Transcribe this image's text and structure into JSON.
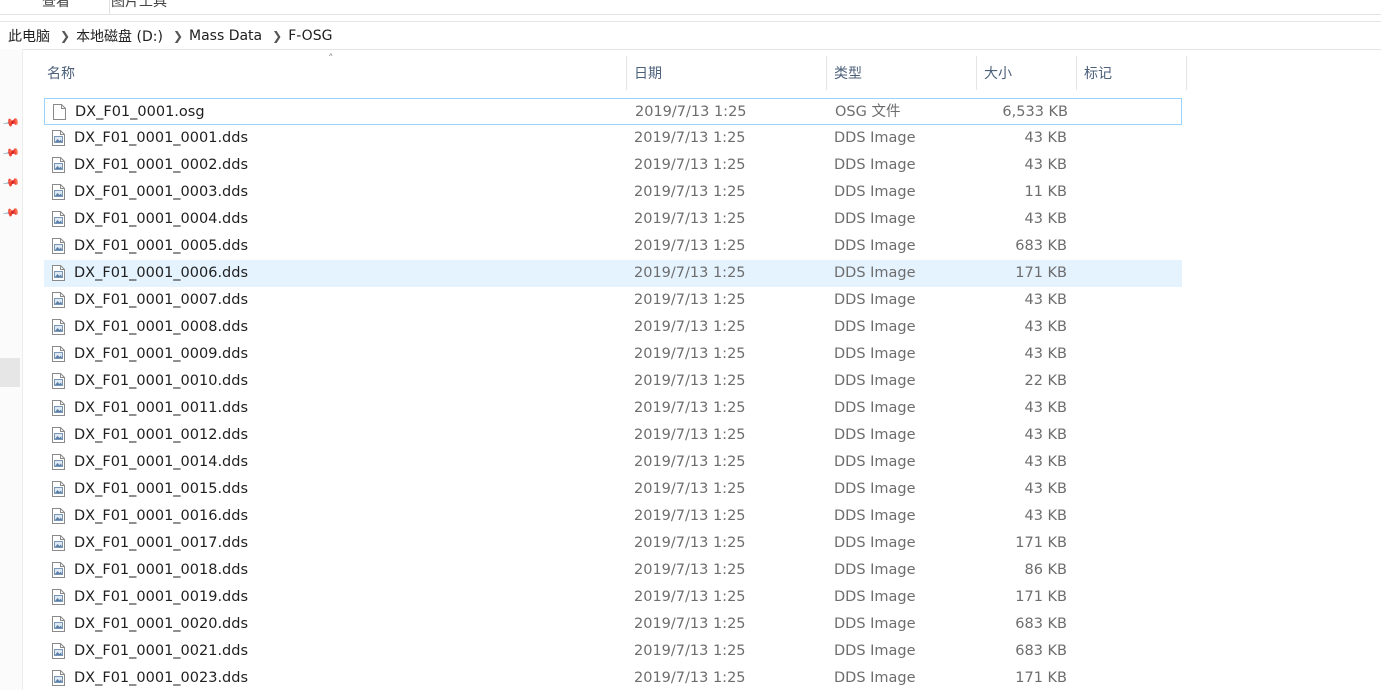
{
  "ribbon": {
    "tabs": [
      "查看",
      "图片工具"
    ]
  },
  "breadcrumb": [
    "此电脑",
    "本地磁盘 (D:)",
    "Mass Data",
    "F-OSG"
  ],
  "columns": {
    "name": "名称",
    "date": "日期",
    "type": "类型",
    "size": "大小",
    "tags": "标记"
  },
  "files": [
    {
      "name": "DX_F01_0001.osg",
      "date": "2019/7/13 1:25",
      "type": "OSG 文件",
      "size": "6,533 KB",
      "icon": "blank-file-icon"
    },
    {
      "name": "DX_F01_0001_0001.dds",
      "date": "2019/7/13 1:25",
      "type": "DDS Image",
      "size": "43 KB",
      "icon": "image-file-icon"
    },
    {
      "name": "DX_F01_0001_0002.dds",
      "date": "2019/7/13 1:25",
      "type": "DDS Image",
      "size": "43 KB",
      "icon": "image-file-icon"
    },
    {
      "name": "DX_F01_0001_0003.dds",
      "date": "2019/7/13 1:25",
      "type": "DDS Image",
      "size": "11 KB",
      "icon": "image-file-icon"
    },
    {
      "name": "DX_F01_0001_0004.dds",
      "date": "2019/7/13 1:25",
      "type": "DDS Image",
      "size": "43 KB",
      "icon": "image-file-icon"
    },
    {
      "name": "DX_F01_0001_0005.dds",
      "date": "2019/7/13 1:25",
      "type": "DDS Image",
      "size": "683 KB",
      "icon": "image-file-icon"
    },
    {
      "name": "DX_F01_0001_0006.dds",
      "date": "2019/7/13 1:25",
      "type": "DDS Image",
      "size": "171 KB",
      "icon": "image-file-icon"
    },
    {
      "name": "DX_F01_0001_0007.dds",
      "date": "2019/7/13 1:25",
      "type": "DDS Image",
      "size": "43 KB",
      "icon": "image-file-icon"
    },
    {
      "name": "DX_F01_0001_0008.dds",
      "date": "2019/7/13 1:25",
      "type": "DDS Image",
      "size": "43 KB",
      "icon": "image-file-icon"
    },
    {
      "name": "DX_F01_0001_0009.dds",
      "date": "2019/7/13 1:25",
      "type": "DDS Image",
      "size": "43 KB",
      "icon": "image-file-icon"
    },
    {
      "name": "DX_F01_0001_0010.dds",
      "date": "2019/7/13 1:25",
      "type": "DDS Image",
      "size": "22 KB",
      "icon": "image-file-icon"
    },
    {
      "name": "DX_F01_0001_0011.dds",
      "date": "2019/7/13 1:25",
      "type": "DDS Image",
      "size": "43 KB",
      "icon": "image-file-icon"
    },
    {
      "name": "DX_F01_0001_0012.dds",
      "date": "2019/7/13 1:25",
      "type": "DDS Image",
      "size": "43 KB",
      "icon": "image-file-icon"
    },
    {
      "name": "DX_F01_0001_0014.dds",
      "date": "2019/7/13 1:25",
      "type": "DDS Image",
      "size": "43 KB",
      "icon": "image-file-icon"
    },
    {
      "name": "DX_F01_0001_0015.dds",
      "date": "2019/7/13 1:25",
      "type": "DDS Image",
      "size": "43 KB",
      "icon": "image-file-icon"
    },
    {
      "name": "DX_F01_0001_0016.dds",
      "date": "2019/7/13 1:25",
      "type": "DDS Image",
      "size": "43 KB",
      "icon": "image-file-icon"
    },
    {
      "name": "DX_F01_0001_0017.dds",
      "date": "2019/7/13 1:25",
      "type": "DDS Image",
      "size": "171 KB",
      "icon": "image-file-icon"
    },
    {
      "name": "DX_F01_0001_0018.dds",
      "date": "2019/7/13 1:25",
      "type": "DDS Image",
      "size": "86 KB",
      "icon": "image-file-icon"
    },
    {
      "name": "DX_F01_0001_0019.dds",
      "date": "2019/7/13 1:25",
      "type": "DDS Image",
      "size": "171 KB",
      "icon": "image-file-icon"
    },
    {
      "name": "DX_F01_0001_0020.dds",
      "date": "2019/7/13 1:25",
      "type": "DDS Image",
      "size": "683 KB",
      "icon": "image-file-icon"
    },
    {
      "name": "DX_F01_0001_0021.dds",
      "date": "2019/7/13 1:25",
      "type": "DDS Image",
      "size": "683 KB",
      "icon": "image-file-icon"
    },
    {
      "name": "DX_F01_0001_0023.dds",
      "date": "2019/7/13 1:25",
      "type": "DDS Image",
      "size": "171 KB",
      "icon": "image-file-icon"
    }
  ],
  "state": {
    "focused_row": 0,
    "hovered_row": 6
  },
  "colors": {
    "hover": "#e5f3ff",
    "focus_border": "#99d1ff",
    "header_text": "#4c607a",
    "meta_text": "#6d6d6d"
  }
}
